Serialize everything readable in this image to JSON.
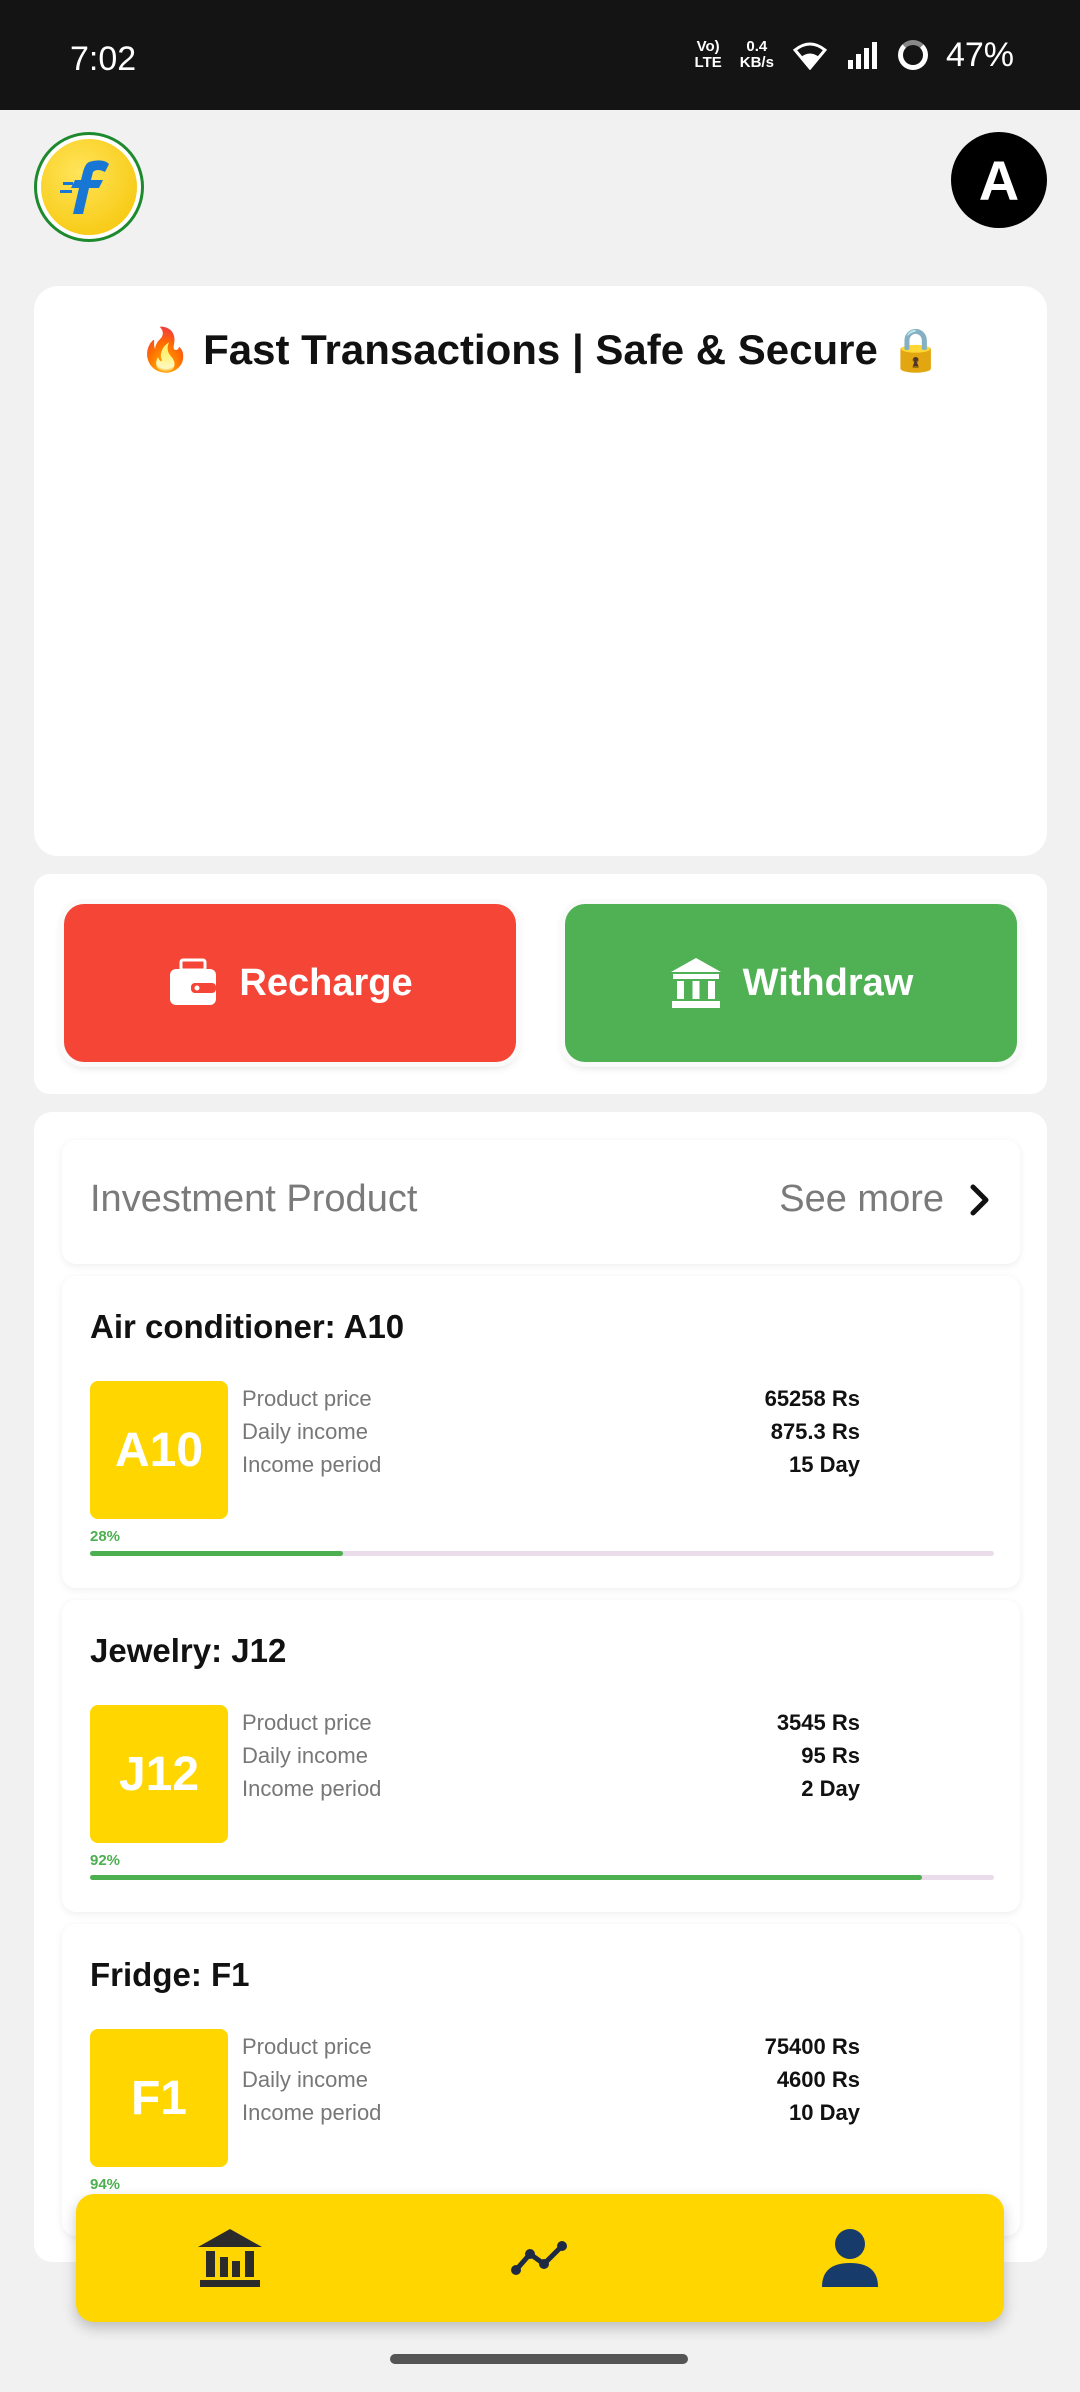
{
  "status_bar": {
    "time": "7:02",
    "network_type_top": "Vo)",
    "network_type_bottom": "LTE",
    "speed_value": "0.4",
    "speed_unit": "KB/s",
    "battery": "47%"
  },
  "header": {
    "logo_icon": "flipkart-logo",
    "avatar_letter": "A"
  },
  "banner": {
    "title": "🔥 Fast Transactions | Safe & Secure 🔒"
  },
  "actions": {
    "recharge_label": "Recharge",
    "withdraw_label": "Withdraw",
    "recharge_color": "#f44536",
    "withdraw_color": "#4fb054"
  },
  "products": {
    "section_title": "Investment Product",
    "see_more": "See more",
    "labels": {
      "price": "Product price",
      "daily": "Daily income",
      "period": "Income period"
    },
    "items": [
      {
        "title": "Air conditioner: A10",
        "code": "A10",
        "price": "65258 Rs",
        "daily": "875.3 Rs",
        "period": "15 Day",
        "progress_label": "28%",
        "progress": 0.28
      },
      {
        "title": "Jewelry: J12",
        "code": "J12",
        "price": "3545 Rs",
        "daily": "95 Rs",
        "period": "2 Day",
        "progress_label": "92%",
        "progress": 0.92
      },
      {
        "title": "Fridge: F1",
        "code": "F1",
        "price": "75400 Rs",
        "daily": "4600 Rs",
        "period": "10 Day",
        "progress_label": "94%",
        "progress": 0.94
      }
    ]
  },
  "bottom_nav": {
    "items": [
      "home-bank-icon",
      "trend-chart-icon",
      "profile-icon"
    ],
    "background": "#ffd600"
  }
}
